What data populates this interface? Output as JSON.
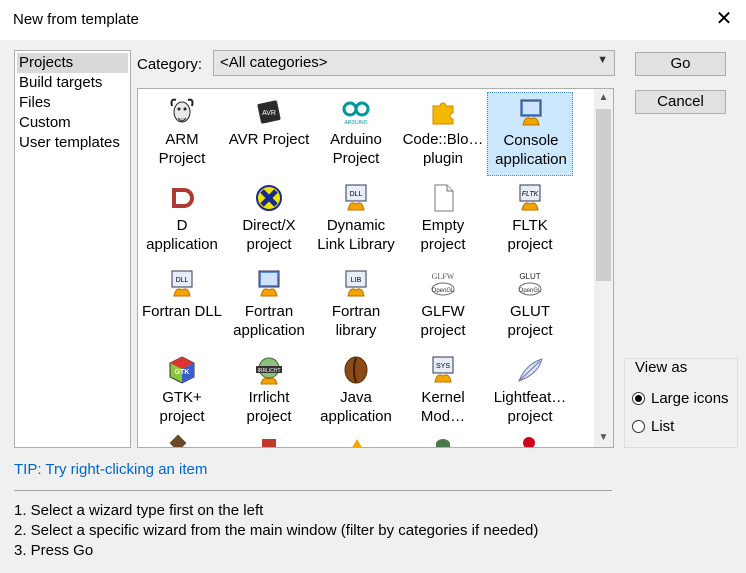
{
  "window": {
    "title": "New from template",
    "close_icon": "close-icon"
  },
  "left_list": {
    "items": [
      "Projects",
      "Build targets",
      "Files",
      "Custom",
      "User templates"
    ],
    "selected": "Projects"
  },
  "category": {
    "label": "Category:",
    "value": "<All categories>"
  },
  "templates": [
    {
      "label": "ARM\nProject",
      "icon": "gnu-icon",
      "selected": false
    },
    {
      "label": "AVR Project",
      "icon": "avr-chip-icon",
      "selected": false
    },
    {
      "label": "Arduino\nProject",
      "icon": "arduino-icon",
      "selected": false
    },
    {
      "label": "Code::Blo…\nplugin",
      "icon": "puzzle-plugin-icon",
      "selected": false
    },
    {
      "label": "Console\napplication",
      "icon": "console-app-icon",
      "selected": true
    },
    {
      "label": "D\napplication",
      "icon": "d-lang-icon",
      "selected": false
    },
    {
      "label": "Direct/X\nproject",
      "icon": "directx-icon",
      "selected": false
    },
    {
      "label": "Dynamic\nLink Library",
      "icon": "dll-icon",
      "selected": false
    },
    {
      "label": "Empty\nproject",
      "icon": "empty-file-icon",
      "selected": false
    },
    {
      "label": "FLTK\nproject",
      "icon": "fltk-icon",
      "selected": false
    },
    {
      "label": "Fortran DLL",
      "icon": "fortran-dll-icon",
      "selected": false
    },
    {
      "label": "Fortran\napplication",
      "icon": "fortran-app-icon",
      "selected": false
    },
    {
      "label": "Fortran\nlibrary",
      "icon": "fortran-lib-icon",
      "selected": false
    },
    {
      "label": "GLFW\nproject",
      "icon": "glfw-icon",
      "selected": false
    },
    {
      "label": "GLUT\nproject",
      "icon": "glut-icon",
      "selected": false
    },
    {
      "label": "GTK+\nproject",
      "icon": "gtk-icon",
      "selected": false
    },
    {
      "label": "Irrlicht\nproject",
      "icon": "irrlicht-icon",
      "selected": false
    },
    {
      "label": "Java\napplication",
      "icon": "java-bean-icon",
      "selected": false
    },
    {
      "label": "Kernel\nMod…",
      "icon": "kernel-sys-icon",
      "selected": false
    },
    {
      "label": "Lightfeat…\nproject",
      "icon": "feather-icon",
      "selected": false
    }
  ],
  "icon_text": {
    "avr": "AVR",
    "arduino": "ARDUINO",
    "dll": "DLL",
    "fltk": "FLTK",
    "lib": "LIB",
    "glfw": "GLFW",
    "glut": "GLUT",
    "opengl": "OpenGL",
    "irrlicht": "IRRLICHT",
    "sys": "SYS",
    "gtk": "GTK"
  },
  "buttons": {
    "go": "Go",
    "cancel": "Cancel"
  },
  "view_as": {
    "title": "View as",
    "options": [
      "Large icons",
      "List"
    ],
    "selected": "Large icons"
  },
  "tip": "TIP: Try right-clicking an item",
  "steps": [
    "1. Select a wizard type first on the left",
    "2. Select a specific wizard from the main window (filter by categories if needed)",
    "3. Press Go"
  ],
  "colors": {
    "selection": "#cce8ff",
    "tip": "#0066cc",
    "dialog_bg": "#f0f0f0"
  }
}
